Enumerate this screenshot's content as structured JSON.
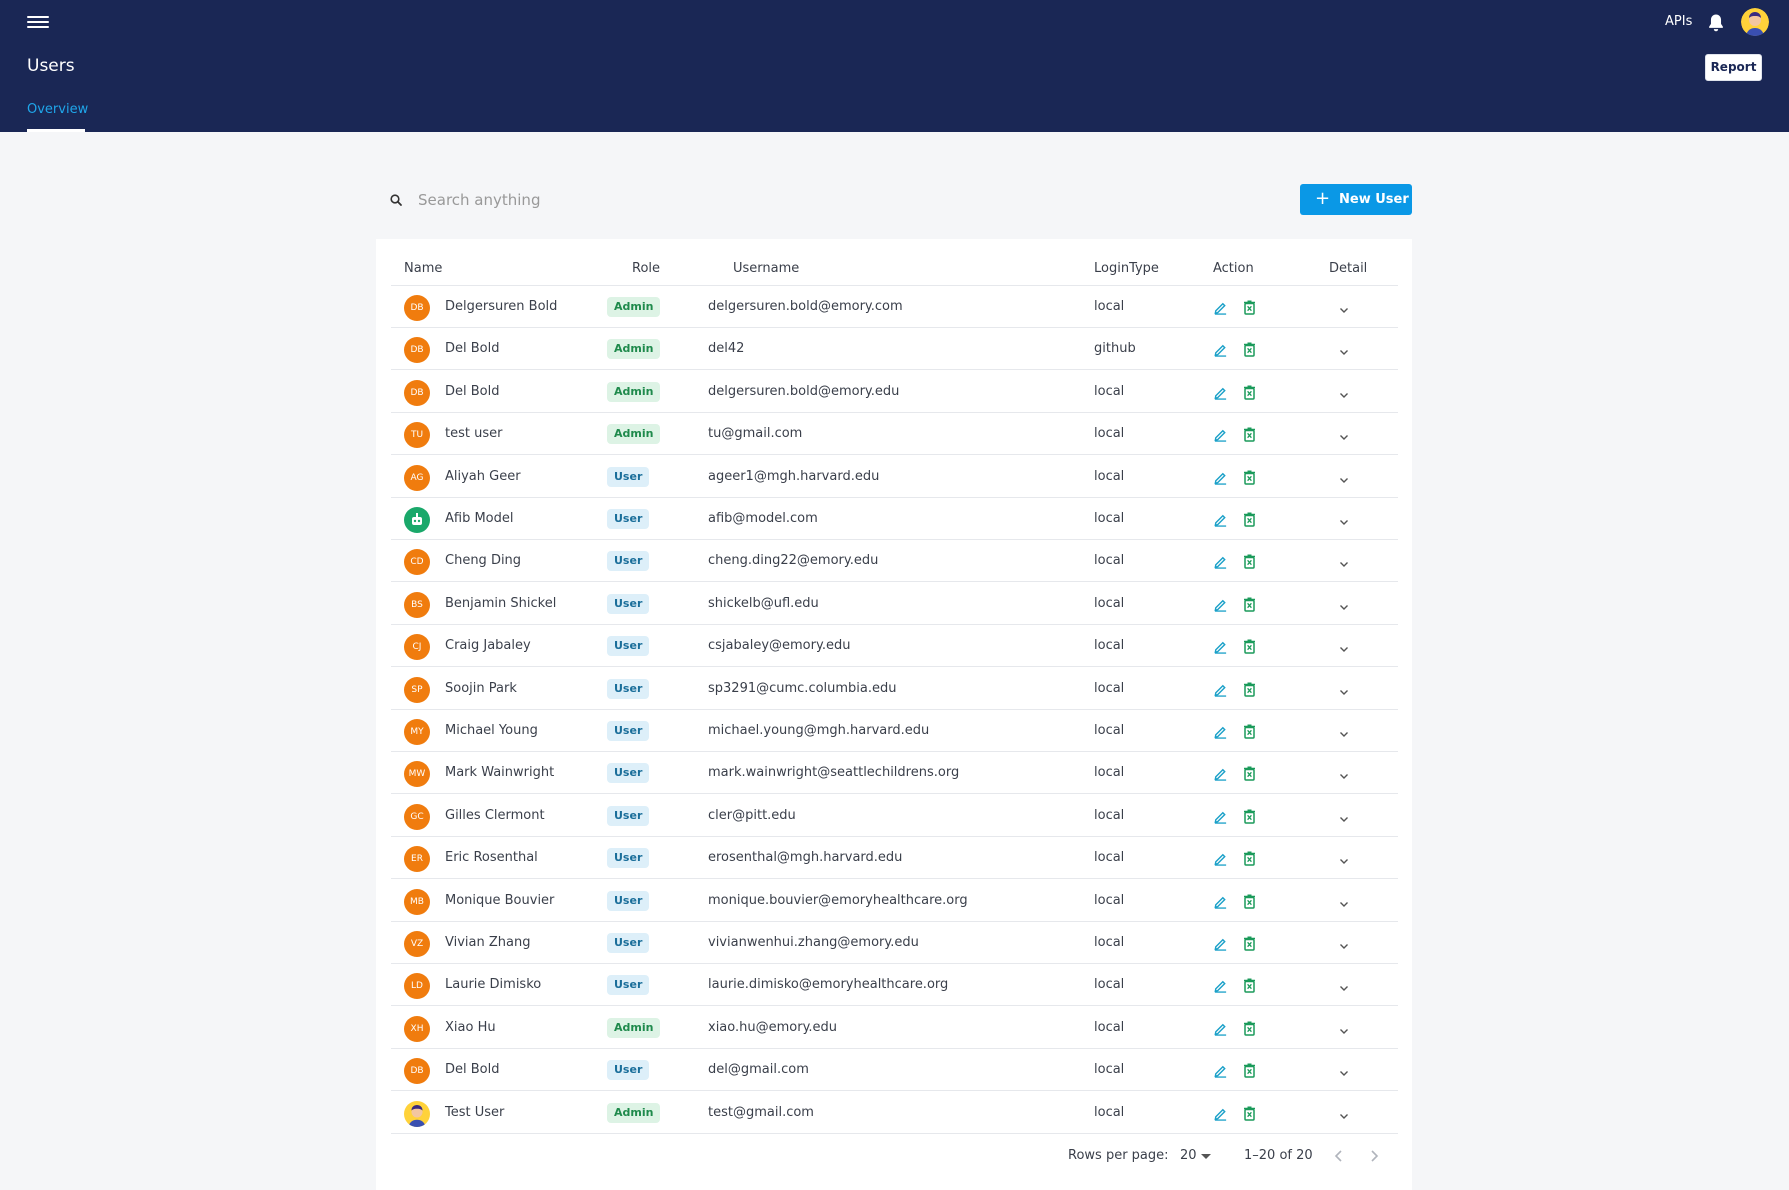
{
  "header": {
    "title": "Users",
    "apis_label": "APIs",
    "report_label": "Report",
    "tab_label": "Overview"
  },
  "search": {
    "placeholder": "Search anything"
  },
  "new_user_label": "New User",
  "table": {
    "columns": [
      "Name",
      "Role",
      "Username",
      "LoginType",
      "Action",
      "Detail"
    ],
    "rows": [
      {
        "initials": "DB",
        "name": "Delgersuren Bold",
        "role": "Admin",
        "username": "delgersuren.bold@emory.com",
        "login": "local"
      },
      {
        "initials": "DB",
        "name": "Del Bold",
        "role": "Admin",
        "username": "del42",
        "login": "github"
      },
      {
        "initials": "DB",
        "name": "Del Bold",
        "role": "Admin",
        "username": "delgersuren.bold@emory.edu",
        "login": "local"
      },
      {
        "initials": "TU",
        "name": "test user",
        "role": "Admin",
        "username": "tu@gmail.com",
        "login": "local"
      },
      {
        "initials": "AG",
        "name": "Aliyah Geer",
        "role": "User",
        "username": "ageer1@mgh.harvard.edu",
        "login": "local"
      },
      {
        "initials": "",
        "name": "Afib Model",
        "role": "User",
        "username": "afib@model.com",
        "login": "local"
      },
      {
        "initials": "CD",
        "name": "Cheng Ding",
        "role": "User",
        "username": "cheng.ding22@emory.edu",
        "login": "local"
      },
      {
        "initials": "BS",
        "name": "Benjamin Shickel",
        "role": "User",
        "username": "shickelb@ufl.edu",
        "login": "local"
      },
      {
        "initials": "CJ",
        "name": "Craig Jabaley",
        "role": "User",
        "username": "csjabaley@emory.edu",
        "login": "local"
      },
      {
        "initials": "SP",
        "name": "Soojin Park",
        "role": "User",
        "username": "sp3291@cumc.columbia.edu",
        "login": "local"
      },
      {
        "initials": "MY",
        "name": "Michael Young",
        "role": "User",
        "username": "michael.young@mgh.harvard.edu",
        "login": "local"
      },
      {
        "initials": "MW",
        "name": "Mark Wainwright",
        "role": "User",
        "username": "mark.wainwright@seattlechildrens.org",
        "login": "local"
      },
      {
        "initials": "GC",
        "name": "Gilles Clermont",
        "role": "User",
        "username": "cler@pitt.edu",
        "login": "local"
      },
      {
        "initials": "ER",
        "name": "Eric Rosenthal",
        "role": "User",
        "username": "erosenthal@mgh.harvard.edu",
        "login": "local"
      },
      {
        "initials": "MB",
        "name": "Monique Bouvier",
        "role": "User",
        "username": "monique.bouvier@emoryhealthcare.org",
        "login": "local"
      },
      {
        "initials": "VZ",
        "name": "Vivian Zhang",
        "role": "User",
        "username": "vivianwenhui.zhang@emory.edu",
        "login": "local"
      },
      {
        "initials": "LD",
        "name": "Laurie Dimisko",
        "role": "User",
        "username": "laurie.dimisko@emoryhealthcare.org",
        "login": "local"
      },
      {
        "initials": "XH",
        "name": "Xiao Hu",
        "role": "Admin",
        "username": "xiao.hu@emory.edu",
        "login": "local"
      },
      {
        "initials": "DB",
        "name": "Del Bold",
        "role": "User",
        "username": "del@gmail.com",
        "login": "local"
      },
      {
        "initials": "",
        "name": "Test User",
        "role": "Admin",
        "username": "test@gmail.com",
        "login": "local"
      }
    ]
  },
  "pagination": {
    "rows_per_page_label": "Rows per page:",
    "rows_per_page": "20",
    "range": "1–20 of 20"
  },
  "colors": {
    "header_bg": "#1a2755",
    "accent": "#0a98e6",
    "avatar_orange": "#f07c0e",
    "admin_badge": "#ddf3e5",
    "user_badge": "#ddeff9"
  }
}
